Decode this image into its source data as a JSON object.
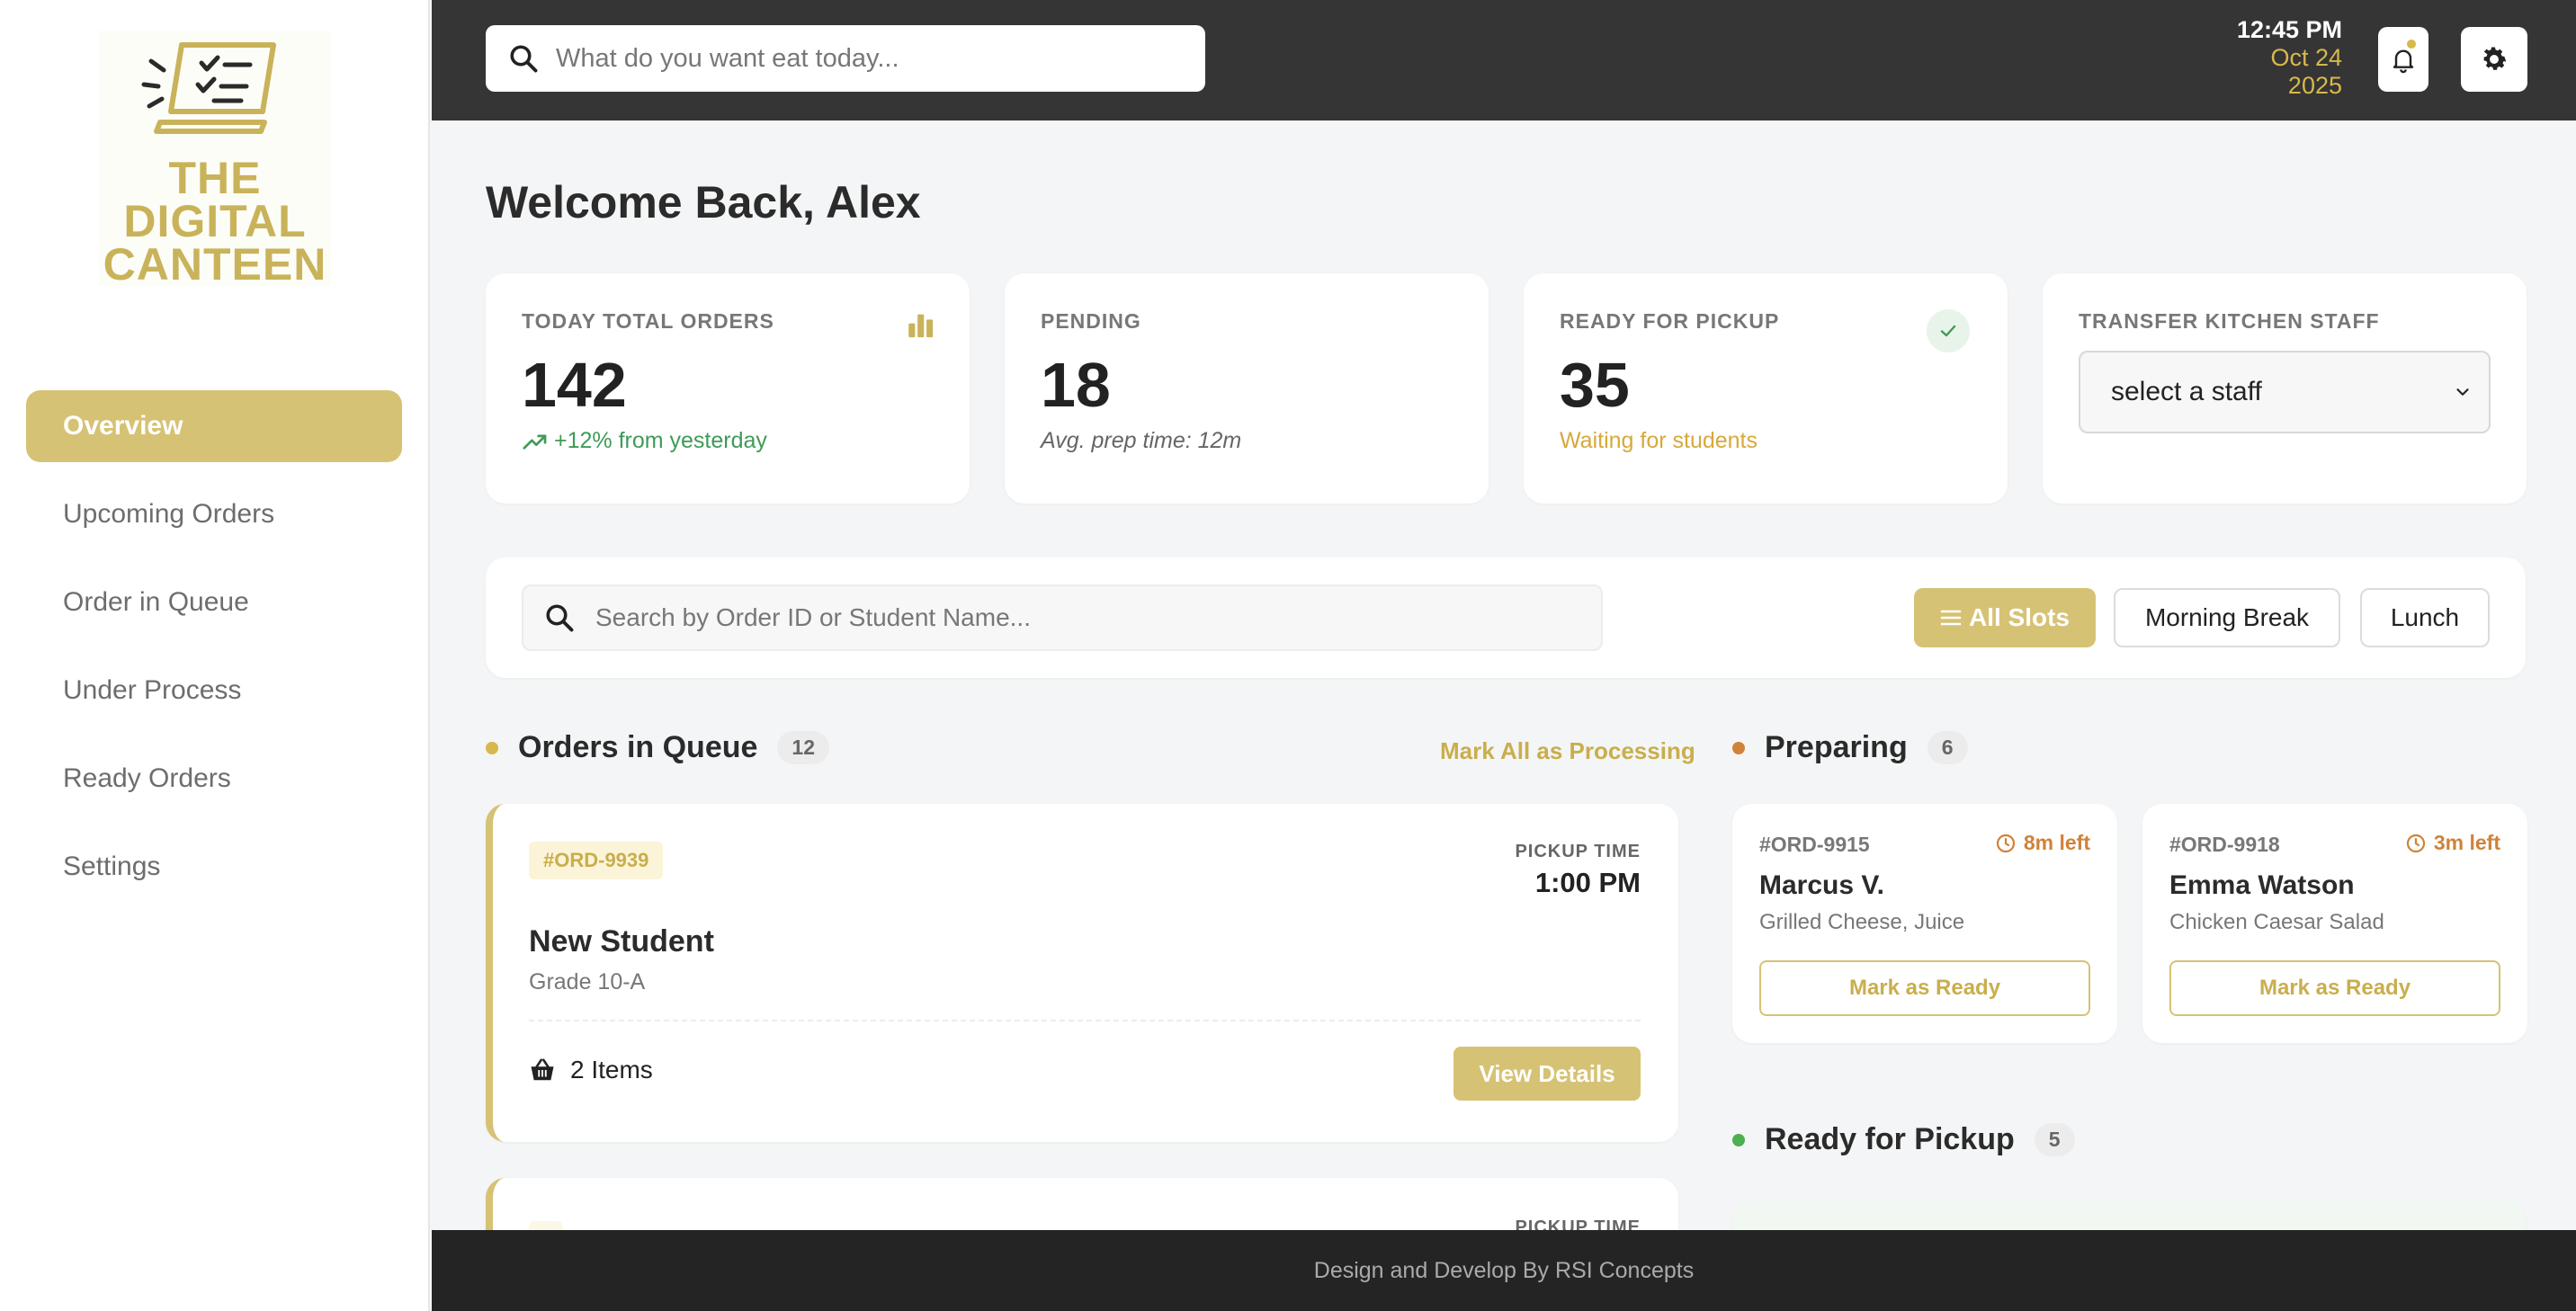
{
  "brand": {
    "logo_lines": [
      "THE",
      "DIGITAL",
      "CANTEEN"
    ],
    "accent": "#d6c274"
  },
  "sidebar": {
    "items": [
      {
        "label": "Overview",
        "active": true
      },
      {
        "label": "Upcoming Orders"
      },
      {
        "label": "Order in Queue"
      },
      {
        "label": "Under Process"
      },
      {
        "label": "Ready Orders"
      },
      {
        "label": "Settings"
      }
    ]
  },
  "header": {
    "search_placeholder": "What do you want eat today...",
    "time": "12:45 PM",
    "date_line1": "Oct 24",
    "date_line2": "2025"
  },
  "main": {
    "welcome": "Welcome Back, Alex",
    "stats": [
      {
        "label": "TODAY TOTAL ORDERS",
        "value": "142",
        "sub": "+12% from yesterday",
        "sub_color": "#3f9a57"
      },
      {
        "label": "PENDING",
        "value": "18",
        "sub": "Avg. prep time: 12m",
        "sub_color": "#666666"
      },
      {
        "label": "READY FOR PICKUP",
        "value": "35",
        "sub": "Waiting for students",
        "sub_color": "#d7a83b"
      },
      {
        "label": "TRANSFER KITCHEN STAFF",
        "select_value": "select a staff"
      }
    ],
    "filter": {
      "search_placeholder": "Search by Order ID or Student Name...",
      "slots": [
        "All Slots",
        "Morning Break",
        "Lunch"
      ]
    },
    "queue": {
      "title": "Orders in Queue",
      "count": "12",
      "action": "Mark All as Processing",
      "orders": [
        {
          "id": "#ORD-9939",
          "pickup_label": "PICKUP TIME",
          "pickup_time": "1:00 PM",
          "name": "New Student",
          "grade": "Grade 10-A",
          "items": "2 Items",
          "button": "View Details"
        }
      ],
      "next_pickup_label": "PICKUP TIME"
    },
    "preparing": {
      "title": "Preparing",
      "count": "6",
      "orders": [
        {
          "id": "#ORD-9915",
          "time_left": "8m left",
          "name": "Marcus V.",
          "items": "Grilled Cheese, Juice",
          "button": "Mark as Ready"
        },
        {
          "id": "#ORD-9918",
          "time_left": "3m left",
          "name": "Emma Watson",
          "items": "Chicken Caesar Salad",
          "button": "Mark as Ready"
        }
      ]
    },
    "ready": {
      "title": "Ready for Pickup",
      "count": "5"
    }
  },
  "footer": {
    "text": "Design and Develop By RSI Concepts"
  }
}
